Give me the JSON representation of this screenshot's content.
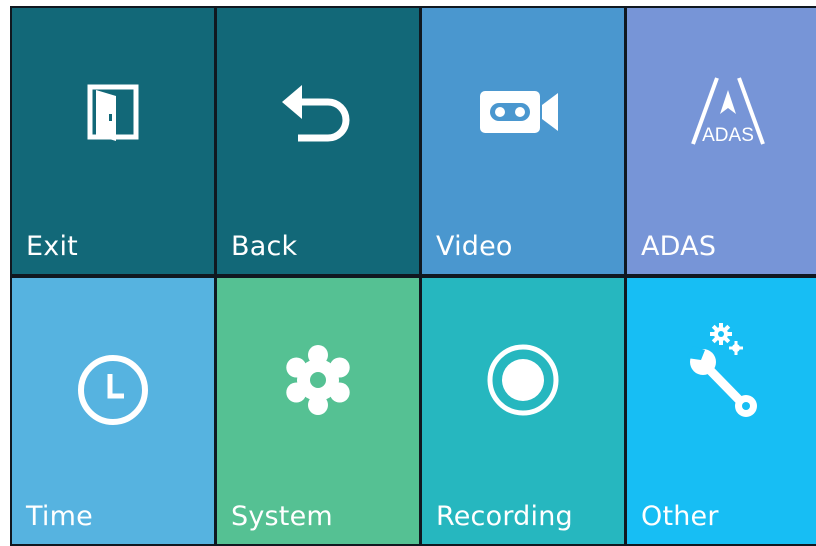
{
  "menu": {
    "tiles": [
      {
        "label": "Exit",
        "icon": "exit-door-icon",
        "color": "#126878"
      },
      {
        "label": "Back",
        "icon": "back-arrow-icon",
        "color": "#126878"
      },
      {
        "label": "Video",
        "icon": "video-camera-icon",
        "color": "#4A97CF"
      },
      {
        "label": "ADAS",
        "icon": "adas-road-icon",
        "color": "#7795D7",
        "icon_text": "ADAS"
      },
      {
        "label": "Time",
        "icon": "clock-icon",
        "color": "#56B3E0"
      },
      {
        "label": "System",
        "icon": "gear-icon",
        "color": "#55C193"
      },
      {
        "label": "Recording",
        "icon": "record-icon",
        "color": "#26B7BF"
      },
      {
        "label": "Other",
        "icon": "wrench-gear-icon",
        "color": "#17BEF4"
      }
    ]
  }
}
